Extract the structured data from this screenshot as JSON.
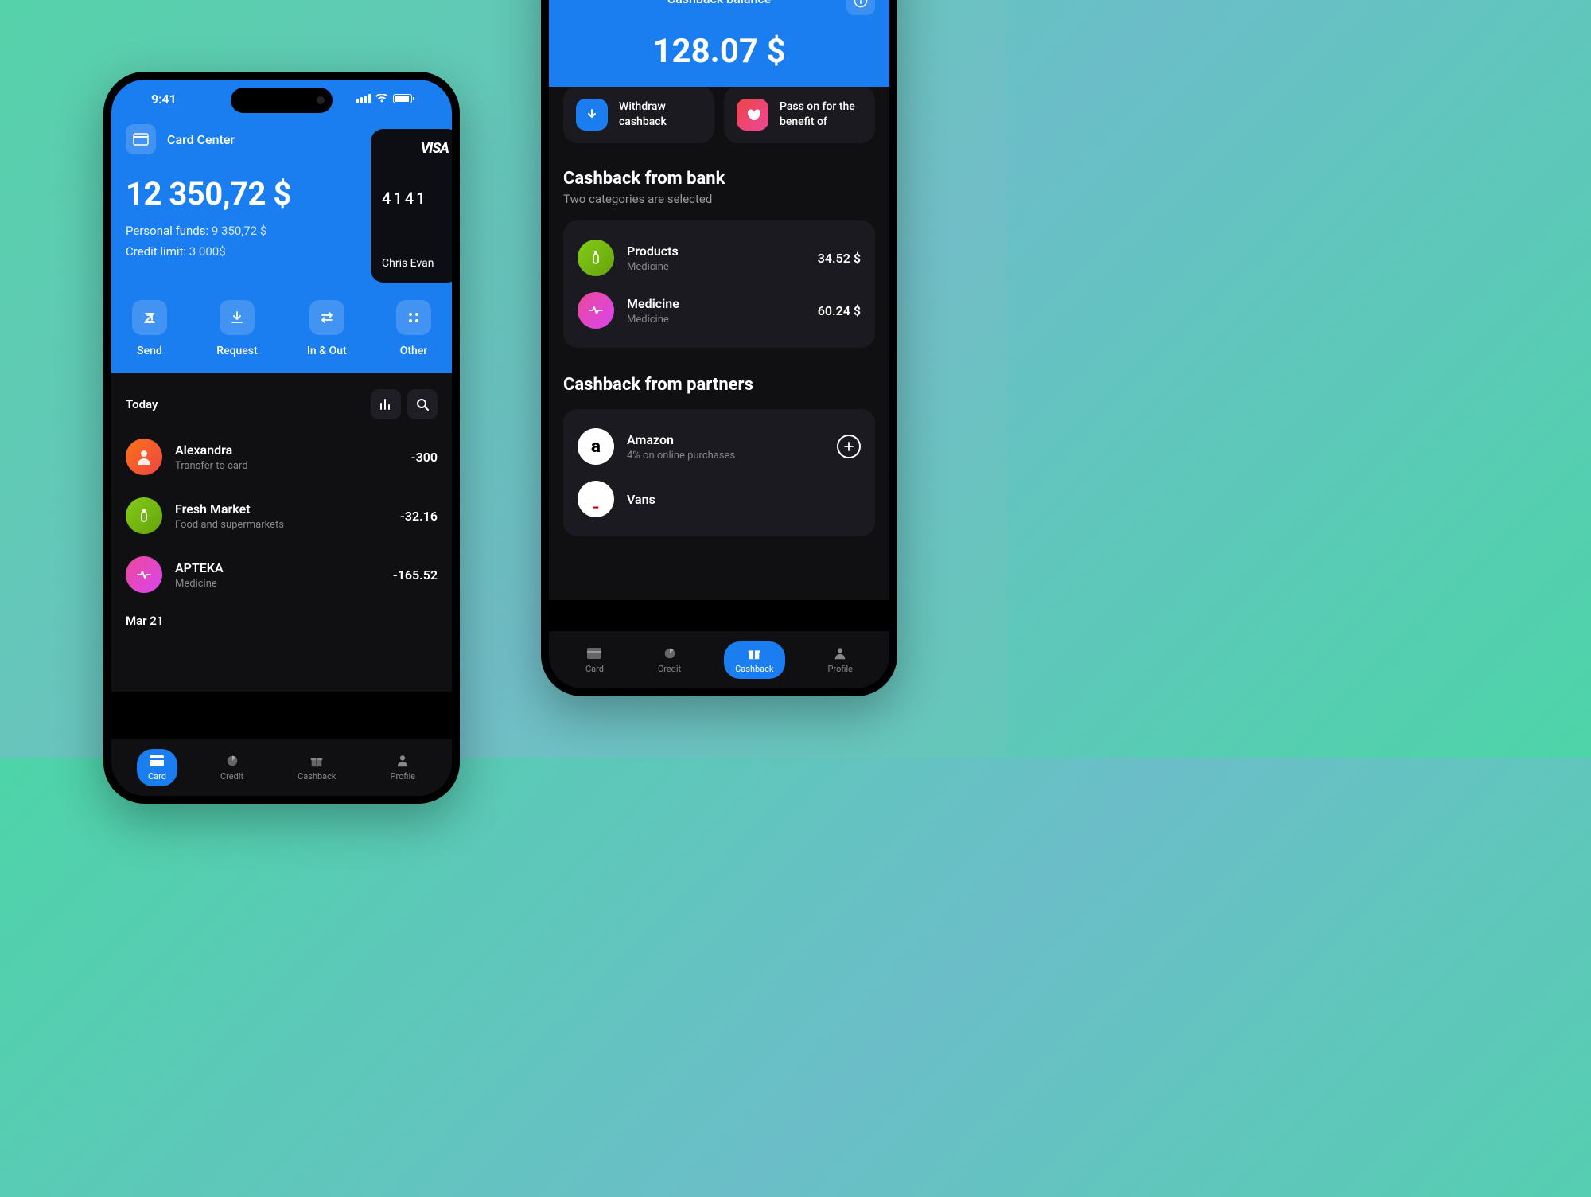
{
  "left": {
    "status": {
      "time": "9:41"
    },
    "header": {
      "label": "Card Center"
    },
    "balance": "12 350,72 $",
    "personal_label": "Personal funds:",
    "personal_value": "9 350,72 $",
    "credit_label": "Credit limit:",
    "credit_value": "3 000$",
    "card": {
      "brand": "VISA",
      "last4": "4141",
      "name": "Chris Evan"
    },
    "actions": [
      {
        "label": "Send"
      },
      {
        "label": "Request"
      },
      {
        "label": "In & Out"
      },
      {
        "label": "Other"
      }
    ],
    "today_label": "Today",
    "transactions": [
      {
        "name": "Alexandra",
        "sub": "Transfer to card",
        "amount": "-300",
        "avatar": "orange",
        "icon": "person"
      },
      {
        "name": "Fresh Market",
        "sub": "Food and supermarkets",
        "amount": "-32.16",
        "avatar": "green",
        "icon": "bottle"
      },
      {
        "name": "APTEKA",
        "sub": "Medicine",
        "amount": "-165.52",
        "avatar": "pink",
        "icon": "heartbeat"
      }
    ],
    "date2": "Mar 21"
  },
  "right": {
    "title": "Cashback balance",
    "balance": "128.07 $",
    "quick": [
      {
        "icon": "download",
        "line1": "Withdraw",
        "line2": "cashback",
        "color": "blue"
      },
      {
        "icon": "heart",
        "line1": "Pass on for the",
        "line2": "benefit of",
        "color": "red"
      }
    ],
    "bank_title": "Cashback from bank",
    "bank_sub": "Two categories are selected",
    "bank_items": [
      {
        "name": "Products",
        "sub": "Medicine",
        "amount": "34.52 $",
        "avatar": "green",
        "icon": "bottle"
      },
      {
        "name": "Medicine",
        "sub": "Medicine",
        "amount": "60.24 $",
        "avatar": "pink",
        "icon": "heartbeat"
      }
    ],
    "partners_title": "Cashback from partners",
    "partners": [
      {
        "name": "Amazon",
        "sub": "4% on online purchases",
        "avatar": "white",
        "logo": "a"
      },
      {
        "name": "Vans",
        "sub": "",
        "avatar": "white",
        "logo": "v"
      }
    ]
  },
  "tabs": [
    {
      "label": "Card"
    },
    {
      "label": "Credit"
    },
    {
      "label": "Cashback"
    },
    {
      "label": "Profile"
    }
  ]
}
